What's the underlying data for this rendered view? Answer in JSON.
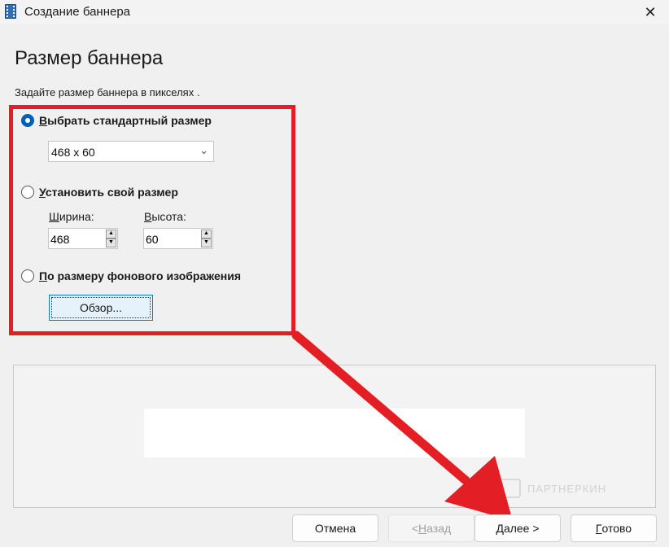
{
  "window": {
    "title": "Создание баннера",
    "close_glyph": "✕"
  },
  "page": {
    "title": "Размер баннера",
    "subtitle": "Задайте размер баннера в пикселях ."
  },
  "options": {
    "standard": {
      "first_letter": "В",
      "rest": "ыбрать стандартный размер",
      "checked": true
    },
    "standard_size": {
      "value": "468 x 60",
      "chevron": "⌄"
    },
    "custom": {
      "first_letter": "У",
      "rest": "становить свой размер",
      "checked": false
    },
    "width": {
      "label_first": "Ш",
      "label_rest": "ирина:",
      "value": "468"
    },
    "height": {
      "label_first": "В",
      "label_rest": "ысота:",
      "value": "60"
    },
    "background": {
      "first_letter": "П",
      "rest": "о размеру фонового изображения",
      "checked": false
    },
    "browse_label": "Обзор..."
  },
  "watermark": "ПАРТНЕРКИН",
  "footer": {
    "cancel": "Отмена",
    "back_prefix": "< ",
    "back_first": "Н",
    "back_rest": "азад",
    "next_first": "Д",
    "next_rest": "алее >",
    "finish_first": "Г",
    "finish_rest": "отово"
  },
  "colors": {
    "annotation": "#e41e25",
    "accent": "#005fb8"
  }
}
